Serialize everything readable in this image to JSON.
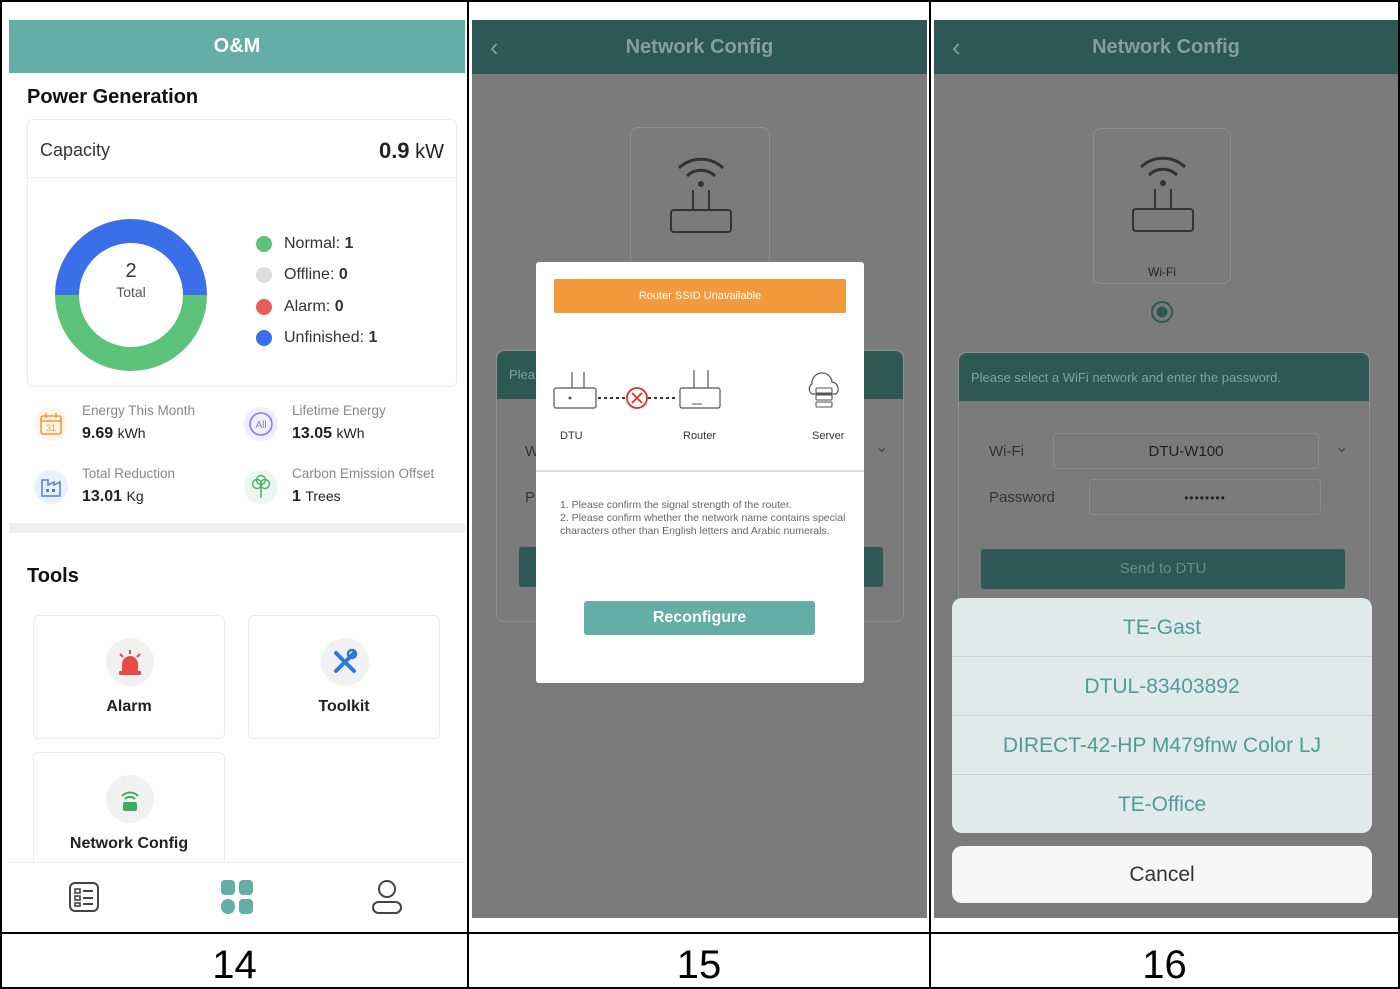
{
  "screens": {
    "om": {
      "header_title": "O&M",
      "power_generation_title": "Power Generation",
      "capacity_label": "Capacity",
      "capacity_value": "0.9",
      "capacity_unit": "kW",
      "donut_total": "2",
      "donut_total_label": "Total",
      "legend": [
        {
          "label": "Normal:",
          "value": "1",
          "color": "#5cc47a"
        },
        {
          "label": "Offline:",
          "value": "0",
          "color": "#dcdcdc"
        },
        {
          "label": "Alarm:",
          "value": "0",
          "color": "#e95c5c"
        },
        {
          "label": "Unfinished:",
          "value": "1",
          "color": "#3b6fea"
        }
      ],
      "stats": [
        {
          "title": "Energy This Month",
          "value": "9.69",
          "unit": "kWh",
          "icon": "calendar-icon",
          "icon_text": "31"
        },
        {
          "title": "Lifetime Energy",
          "value": "13.05",
          "unit": "kWh",
          "icon": "all-icon",
          "icon_text": "All"
        },
        {
          "title": "Total Reduction",
          "value": "13.01",
          "unit": "Kg",
          "icon": "factory-icon"
        },
        {
          "title": "Carbon Emission Offset",
          "value": "1",
          "unit": "Trees",
          "icon": "tree-icon"
        }
      ],
      "tools_title": "Tools",
      "tools": [
        {
          "label": "Alarm",
          "icon": "alarm-icon"
        },
        {
          "label": "Toolkit",
          "icon": "toolkit-icon"
        },
        {
          "label": "Network Config",
          "icon": "network-config-icon"
        }
      ],
      "nav": [
        "list-icon",
        "grid-icon",
        "user-icon"
      ]
    },
    "network_error": {
      "header_title": "Network Config",
      "partial_text_1": "Plea",
      "partial_text_2": "W",
      "partial_text_3": "P",
      "warning": "Router SSID Unavailable",
      "nodes": [
        "DTU",
        "Router",
        "Server"
      ],
      "note_1": "1. Please confirm the signal strength of the router.",
      "note_2": "2. Please confirm whether the network name contains special characters other than English letters and Arabic numerals.",
      "reconfigure": "Reconfigure"
    },
    "network_select": {
      "header_title": "Network Config",
      "wifi_card_label": "Wi-Fi",
      "instruction": "Please select a WiFi network and enter the password.",
      "wifi_label": "Wi-Fi",
      "wifi_value": "DTU-W100",
      "password_label": "Password",
      "password_value": "••••••••",
      "send_button": "Send to DTU",
      "options": [
        "TE-Gast",
        "DTUL-83403892",
        "DIRECT-42-HP M479fnw Color LJ",
        "TE-Office"
      ],
      "cancel": "Cancel"
    }
  },
  "captions": [
    "14",
    "15",
    "16"
  ],
  "colors": {
    "teal": "#65ada7",
    "dark_teal": "#2d5853",
    "orange": "#f39a3d"
  }
}
